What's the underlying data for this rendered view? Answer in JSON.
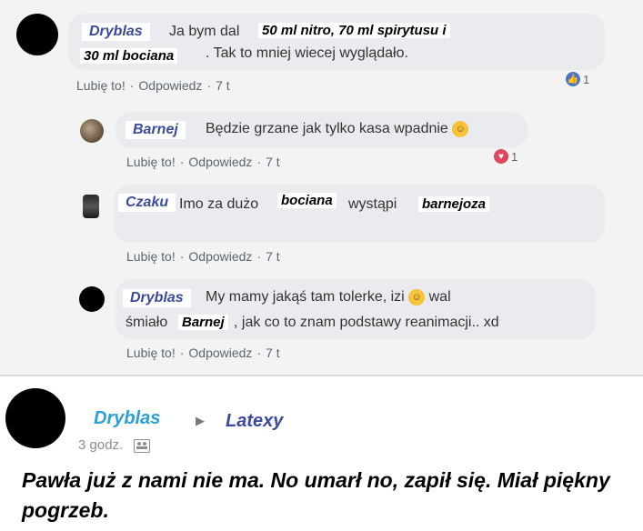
{
  "comments": [
    {
      "author": "Dryblas",
      "text_before": "Ja bym dal",
      "overlay_1": "50 ml nitro, 70 ml spirytusu i",
      "overlay_2": "30 ml bociana",
      "text_after": ". Tak to mniej wiecej wyglądało.",
      "like_label": "Lubię to!",
      "reply_label": "Odpowiedz",
      "time": "7 t",
      "reaction_count": "1",
      "reaction_type": "like"
    },
    {
      "author": "Barnej",
      "text": "Będzie grzane jak tylko kasa wpadnie",
      "like_label": "Lubię to!",
      "reply_label": "Odpowiedz",
      "time": "7 t",
      "reaction_count": "1",
      "reaction_type": "love"
    },
    {
      "author": "Czaku",
      "text_1": "Imo za dużo",
      "overlay_1": "bociana",
      "text_2": "wystąpi",
      "overlay_2": "barnejoza",
      "like_label": "Lubię to!",
      "reply_label": "Odpowiedz",
      "time": "7 t"
    },
    {
      "author": "Dryblas",
      "text_1": "My mamy jakąś tam tolerke, izi",
      "text_2": "wal",
      "text_3": "śmiało",
      "overlay_1": "Barnej",
      "text_4": ", jak co to znam podstawy reanimacji.. xd",
      "like_label": "Lubię to!",
      "reply_label": "Odpowiedz",
      "time": "7 t"
    }
  ],
  "post": {
    "author": "Dryblas",
    "arrow": "▶",
    "target": "Latexy",
    "time": "3 godz.",
    "privacy_icon": "friends-icon",
    "text": "Pawła już z nami nie ma. No umarł no, zapił się. Miał piękny pogrzeb."
  },
  "colors": {
    "name_blue": "#3b4a9c",
    "post_author": "#2a9fd8",
    "like_blue": "#4a76c9",
    "love_red": "#e0465b"
  }
}
